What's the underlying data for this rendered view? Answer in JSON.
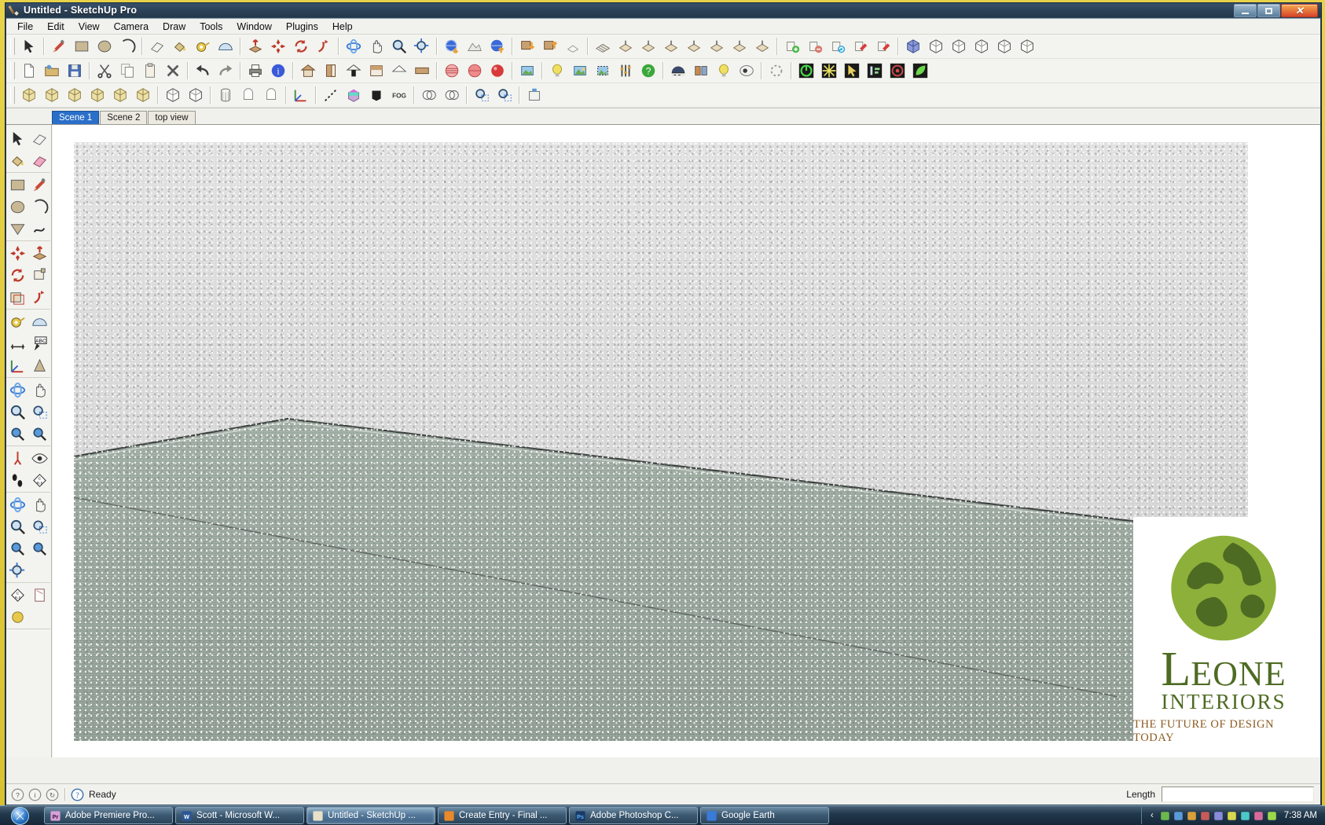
{
  "window": {
    "title": "Untitled - SketchUp Pro",
    "app_icon": "sketchup-pencil-icon",
    "controls": {
      "minimize": "minimize-button",
      "maximize": "maximize-button",
      "close": "close-button",
      "close_glyph": "✕"
    }
  },
  "menubar": {
    "items": [
      {
        "label": "File"
      },
      {
        "label": "Edit"
      },
      {
        "label": "View"
      },
      {
        "label": "Camera"
      },
      {
        "label": "Draw"
      },
      {
        "label": "Tools"
      },
      {
        "label": "Window"
      },
      {
        "label": "Plugins"
      },
      {
        "label": "Help"
      }
    ]
  },
  "toolbars": {
    "row1": [
      {
        "name": "select-tool",
        "icon": "arrow-cursor-icon",
        "sep_after": true
      },
      {
        "name": "line-tool",
        "icon": "pencil-icon"
      },
      {
        "name": "rectangle-tool",
        "icon": "rectangle-icon"
      },
      {
        "name": "circle-tool",
        "icon": "circle-icon"
      },
      {
        "name": "arc-tool",
        "icon": "arc-icon",
        "sep_after": true
      },
      {
        "name": "eraser-tool",
        "icon": "eraser-icon"
      },
      {
        "name": "paint-bucket-tool",
        "icon": "paint-bucket-icon"
      },
      {
        "name": "tape-measure-tool",
        "icon": "tape-measure-icon"
      },
      {
        "name": "dimension-tool",
        "icon": "protractor-icon",
        "sep_after": true
      },
      {
        "name": "push-pull-tool",
        "icon": "push-pull-icon"
      },
      {
        "name": "move-tool",
        "icon": "move-cross-icon"
      },
      {
        "name": "rotate-tool",
        "icon": "rotate-arrows-icon"
      },
      {
        "name": "follow-me-tool",
        "icon": "follow-me-icon",
        "sep_after": true
      },
      {
        "name": "orbit-tool",
        "icon": "orbit-icon"
      },
      {
        "name": "pan-tool",
        "icon": "hand-icon"
      },
      {
        "name": "zoom-tool",
        "icon": "magnifier-icon"
      },
      {
        "name": "zoom-extents-tool",
        "icon": "zoom-extents-icon",
        "sep_after": true
      },
      {
        "name": "geo-location-add",
        "icon": "globe-down-icon"
      },
      {
        "name": "geo-location-toggle",
        "icon": "terrain-icon"
      },
      {
        "name": "geo-location-up",
        "icon": "globe-up-icon",
        "sep_after": true
      },
      {
        "name": "component-get",
        "icon": "warehouse-down-icon"
      },
      {
        "name": "component-share",
        "icon": "warehouse-up-icon"
      },
      {
        "name": "model-preview",
        "icon": "model-ghost-icon",
        "sep_after": true
      },
      {
        "name": "sandbox-from-contours",
        "icon": "mesh-icon"
      },
      {
        "name": "sandbox-from-scratch",
        "icon": "grid-t-icon"
      },
      {
        "name": "sandbox-smoove",
        "icon": "grid-t2-icon"
      },
      {
        "name": "sandbox-stamp",
        "icon": "stamp-icon"
      },
      {
        "name": "sandbox-drape",
        "icon": "drape-icon"
      },
      {
        "name": "sandbox-add-detail",
        "icon": "detail-icon"
      },
      {
        "name": "sandbox-flip-edge",
        "icon": "flip-edge-icon"
      },
      {
        "name": "sandbox-extra",
        "icon": "surface-icon",
        "sep_after": true
      },
      {
        "name": "layer-add",
        "icon": "layer-add-icon"
      },
      {
        "name": "layer-remove",
        "icon": "layer-remove-icon"
      },
      {
        "name": "layer-refresh",
        "icon": "layer-refresh-icon"
      },
      {
        "name": "style-update",
        "icon": "style-update-icon"
      },
      {
        "name": "style-new",
        "icon": "style-new-icon",
        "sep_after": true
      },
      {
        "name": "view-iso",
        "icon": "iso-cube-icon"
      },
      {
        "name": "view-top",
        "icon": "top-cube-icon"
      },
      {
        "name": "view-front",
        "icon": "front-cube-icon"
      },
      {
        "name": "view-right",
        "icon": "right-cube-icon"
      },
      {
        "name": "view-back",
        "icon": "back-cube-icon"
      },
      {
        "name": "view-left",
        "icon": "left-cube-icon"
      }
    ],
    "row2": [
      {
        "name": "new-file",
        "icon": "document-icon"
      },
      {
        "name": "open-file",
        "icon": "folder-open-icon"
      },
      {
        "name": "save-file",
        "icon": "floppy-disk-icon",
        "sep_after": true
      },
      {
        "name": "cut",
        "icon": "scissors-icon"
      },
      {
        "name": "copy",
        "icon": "copy-icon"
      },
      {
        "name": "paste",
        "icon": "clipboard-icon"
      },
      {
        "name": "delete",
        "icon": "x-delete-icon",
        "sep_after": true
      },
      {
        "name": "undo",
        "icon": "undo-arrow-icon"
      },
      {
        "name": "redo",
        "icon": "redo-arrow-icon",
        "sep_after": true
      },
      {
        "name": "print",
        "icon": "printer-icon"
      },
      {
        "name": "model-info",
        "icon": "info-circle-icon",
        "sep_after": true
      },
      {
        "name": "house-tool-1",
        "icon": "house-icon"
      },
      {
        "name": "house-tool-2",
        "icon": "door-icon"
      },
      {
        "name": "house-tool-3",
        "icon": "house-dark-icon"
      },
      {
        "name": "house-tool-4",
        "icon": "window-icon"
      },
      {
        "name": "house-tool-5",
        "icon": "roof-icon"
      },
      {
        "name": "house-tool-6",
        "icon": "wall-icon",
        "sep_after": true
      },
      {
        "name": "style-wire",
        "icon": "sphere-wire-icon"
      },
      {
        "name": "style-hidden",
        "icon": "sphere-hidden-icon"
      },
      {
        "name": "style-shaded",
        "icon": "sphere-red-icon",
        "sep_after": true
      },
      {
        "name": "photo-match",
        "icon": "photo-icon",
        "sep_after": true
      },
      {
        "name": "light-bulb-tool",
        "icon": "bulb-icon"
      },
      {
        "name": "render-scene",
        "icon": "landscape-icon"
      },
      {
        "name": "render-region",
        "icon": "landscape-region-icon"
      },
      {
        "name": "render-settings",
        "icon": "sliders-icon"
      },
      {
        "name": "render-help",
        "icon": "question-green-icon",
        "sep_after": true
      },
      {
        "name": "environment-sky",
        "icon": "sky-dome-icon"
      },
      {
        "name": "material-editor",
        "icon": "material-icon"
      },
      {
        "name": "light-editor",
        "icon": "yellow-bulb-icon"
      },
      {
        "name": "preview-window",
        "icon": "preview-icon",
        "sep_after": true
      },
      {
        "name": "progress-gear",
        "icon": "gear-dotted-icon",
        "sep_after": true
      },
      {
        "name": "plugin-power",
        "icon": "power-green-icon"
      },
      {
        "name": "plugin-star",
        "icon": "sparkle-icon"
      },
      {
        "name": "plugin-pick",
        "icon": "cursor-yellow-icon"
      },
      {
        "name": "plugin-align",
        "icon": "align-icon"
      },
      {
        "name": "plugin-target",
        "icon": "target-icon"
      },
      {
        "name": "plugin-leaf",
        "icon": "leaf-icon"
      }
    ],
    "row3": [
      {
        "name": "solid-tool-1",
        "icon": "solid-cube-1-icon"
      },
      {
        "name": "solid-tool-2",
        "icon": "solid-cube-2-icon"
      },
      {
        "name": "solid-tool-3",
        "icon": "solid-cube-3-icon"
      },
      {
        "name": "solid-tool-4",
        "icon": "solid-cube-4-icon"
      },
      {
        "name": "solid-tool-5",
        "icon": "solid-cube-5-icon"
      },
      {
        "name": "solid-tool-6",
        "icon": "solid-cube-6-icon",
        "sep_after": true
      },
      {
        "name": "color-cube",
        "icon": "color-cube-icon"
      },
      {
        "name": "plain-cube",
        "icon": "plain-cube-icon",
        "sep_after": true
      },
      {
        "name": "mesh-cylinder",
        "icon": "cylinder-mesh-icon"
      },
      {
        "name": "round-corner",
        "icon": "round-corner-icon"
      },
      {
        "name": "soften-edges",
        "icon": "soften-icon",
        "sep_after": true
      },
      {
        "name": "axes-tool",
        "icon": "axes-icon",
        "sep_after": true
      },
      {
        "name": "dashed-line-tool",
        "icon": "dashed-line-icon"
      },
      {
        "name": "layered-box",
        "icon": "layered-box-icon"
      },
      {
        "name": "black-solid",
        "icon": "black-solid-icon"
      },
      {
        "name": "fog-tool",
        "icon": "fog-label-icon",
        "sep_after": true
      },
      {
        "name": "intersect-1",
        "icon": "boolean-1-icon"
      },
      {
        "name": "intersect-2",
        "icon": "boolean-2-icon",
        "sep_after": true
      },
      {
        "name": "zoom-window-1",
        "icon": "zoom-window-1-icon"
      },
      {
        "name": "zoom-window-2",
        "icon": "zoom-window-2-icon",
        "sep_after": true
      },
      {
        "name": "scene-export",
        "icon": "scene-export-icon"
      }
    ]
  },
  "scene_tabs": {
    "items": [
      {
        "label": "Scene 1",
        "active": true
      },
      {
        "label": "Scene 2",
        "active": false
      },
      {
        "label": "top view",
        "active": false
      }
    ]
  },
  "palette": {
    "groups": [
      {
        "items": [
          {
            "name": "palette-select",
            "icon": "arrow-cursor-icon"
          },
          {
            "name": "palette-eraser",
            "icon": "eraser-icon"
          },
          {
            "name": "palette-paint",
            "icon": "paint-bucket-icon"
          },
          {
            "name": "palette-eraser-pink",
            "icon": "eraser-pink-icon"
          }
        ]
      },
      {
        "items": [
          {
            "name": "palette-rectangle",
            "icon": "rectangle-icon"
          },
          {
            "name": "palette-line",
            "icon": "pencil-icon"
          },
          {
            "name": "palette-circle",
            "icon": "circle-icon"
          },
          {
            "name": "palette-arc",
            "icon": "arc-icon"
          },
          {
            "name": "palette-polygon",
            "icon": "polygon-icon"
          },
          {
            "name": "palette-freehand",
            "icon": "freehand-icon"
          }
        ]
      },
      {
        "items": [
          {
            "name": "palette-move",
            "icon": "move-cross-icon"
          },
          {
            "name": "palette-push-pull",
            "icon": "push-pull-icon"
          },
          {
            "name": "palette-rotate",
            "icon": "rotate-arrows-icon"
          },
          {
            "name": "palette-scale",
            "icon": "scale-icon"
          },
          {
            "name": "palette-offset",
            "icon": "offset-icon"
          },
          {
            "name": "palette-follow-me",
            "icon": "follow-me-icon"
          }
        ]
      },
      {
        "items": [
          {
            "name": "palette-tape-measure",
            "icon": "tape-measure-icon"
          },
          {
            "name": "palette-protractor",
            "icon": "protractor-icon"
          },
          {
            "name": "palette-dimension",
            "icon": "dimension-icon"
          },
          {
            "name": "palette-text",
            "icon": "abc-text-icon"
          },
          {
            "name": "palette-axes",
            "icon": "axes-icon"
          },
          {
            "name": "palette-3d-text",
            "icon": "three-d-text-icon"
          }
        ]
      },
      {
        "items": [
          {
            "name": "palette-orbit",
            "icon": "orbit-icon"
          },
          {
            "name": "palette-pan",
            "icon": "hand-icon"
          },
          {
            "name": "palette-zoom",
            "icon": "magnifier-icon"
          },
          {
            "name": "palette-zoom-window",
            "icon": "zoom-window-icon"
          },
          {
            "name": "palette-previous-view",
            "icon": "zoom-previous-icon"
          },
          {
            "name": "palette-next-view",
            "icon": "zoom-next-icon"
          }
        ]
      },
      {
        "items": [
          {
            "name": "palette-position-camera",
            "icon": "position-camera-icon"
          },
          {
            "name": "palette-look-around",
            "icon": "eye-icon"
          },
          {
            "name": "palette-walk",
            "icon": "footprints-icon"
          },
          {
            "name": "palette-section-plane",
            "icon": "section-plane-icon"
          }
        ]
      },
      {
        "items": [
          {
            "name": "palette-orbit-2",
            "icon": "orbit-icon"
          },
          {
            "name": "palette-pan-2",
            "icon": "hand-icon"
          },
          {
            "name": "palette-zoom-2",
            "icon": "magnifier-icon"
          },
          {
            "name": "palette-zoom-window-2",
            "icon": "zoom-window-icon"
          },
          {
            "name": "palette-previous-view-2",
            "icon": "zoom-previous-icon"
          },
          {
            "name": "palette-next-view-2",
            "icon": "zoom-next-icon"
          },
          {
            "name": "palette-zoom-extents-2",
            "icon": "zoom-extents-icon"
          }
        ]
      },
      {
        "items": [
          {
            "name": "palette-section-tool",
            "icon": "section-plane-icon"
          },
          {
            "name": "palette-page-tool",
            "icon": "page-icon"
          },
          {
            "name": "palette-extra-tool",
            "icon": "extra-tool-icon"
          }
        ]
      }
    ]
  },
  "canvas": {
    "model_name": "interior-room-model",
    "wall_color": "#d8d8d8",
    "floor_color": "#97a69c",
    "background": "#ffffff"
  },
  "logo": {
    "name": "leone-interiors-logo",
    "globe_icon": "green-globe-icon",
    "word_first_letter": "L",
    "word_rest": "EONE",
    "accent_letter": "O",
    "subtitle": "INTERIORS",
    "tagline": "THE FUTURE OF DESIGN TODAY",
    "colors": {
      "green": "#4e6b23",
      "light_green": "#8cb03a",
      "brown": "#8a5a20"
    }
  },
  "statusbar": {
    "icons": [
      {
        "name": "status-info-icon",
        "glyph": "?"
      },
      {
        "name": "status-person-icon",
        "glyph": "i"
      },
      {
        "name": "status-refresh-icon",
        "glyph": "↻"
      }
    ],
    "help_icon": "question-circle-icon",
    "message": "Ready",
    "length_label": "Length",
    "length_value": ""
  },
  "taskbar": {
    "start_button": "start-orb-button",
    "items": [
      {
        "label": "Adobe Premiere Pro...",
        "icon": "premiere-icon",
        "badge": "Pr",
        "badge_bg": "#d8a0d8",
        "badge_fg": "#3a1040",
        "active": false
      },
      {
        "label": "Scott - Microsoft W...",
        "icon": "word-icon",
        "badge": "W",
        "badge_bg": "#2b5797",
        "badge_fg": "#ffffff",
        "active": false
      },
      {
        "label": "Untitled - SketchUp ...",
        "icon": "sketchup-icon",
        "badge": "",
        "badge_bg": "#e8e0c8",
        "badge_fg": "#8a5a2a",
        "active": true
      },
      {
        "label": "Create Entry - Final ...",
        "icon": "firefox-icon",
        "badge": "",
        "badge_bg": "#e8892a",
        "badge_fg": "#ffffff",
        "active": false
      },
      {
        "label": "Adobe Photoshop C...",
        "icon": "photoshop-icon",
        "badge": "Ps",
        "badge_bg": "#1a3a6b",
        "badge_fg": "#5ab0f0",
        "active": false
      },
      {
        "label": "Google Earth",
        "icon": "google-earth-icon",
        "badge": "",
        "badge_bg": "#3a7ad8",
        "badge_fg": "#ffffff",
        "active": false
      }
    ],
    "tray": {
      "expand_glyph": "‹",
      "icons": [
        {
          "name": "tray-shield-icon"
        },
        {
          "name": "tray-network-icon"
        },
        {
          "name": "tray-app-icon"
        },
        {
          "name": "tray-update-icon"
        },
        {
          "name": "tray-alert-icon"
        },
        {
          "name": "tray-folder-icon"
        },
        {
          "name": "tray-monitor-icon"
        },
        {
          "name": "tray-volume-icon"
        },
        {
          "name": "tray-flag-icon"
        }
      ],
      "clock": "7:38 AM"
    }
  }
}
